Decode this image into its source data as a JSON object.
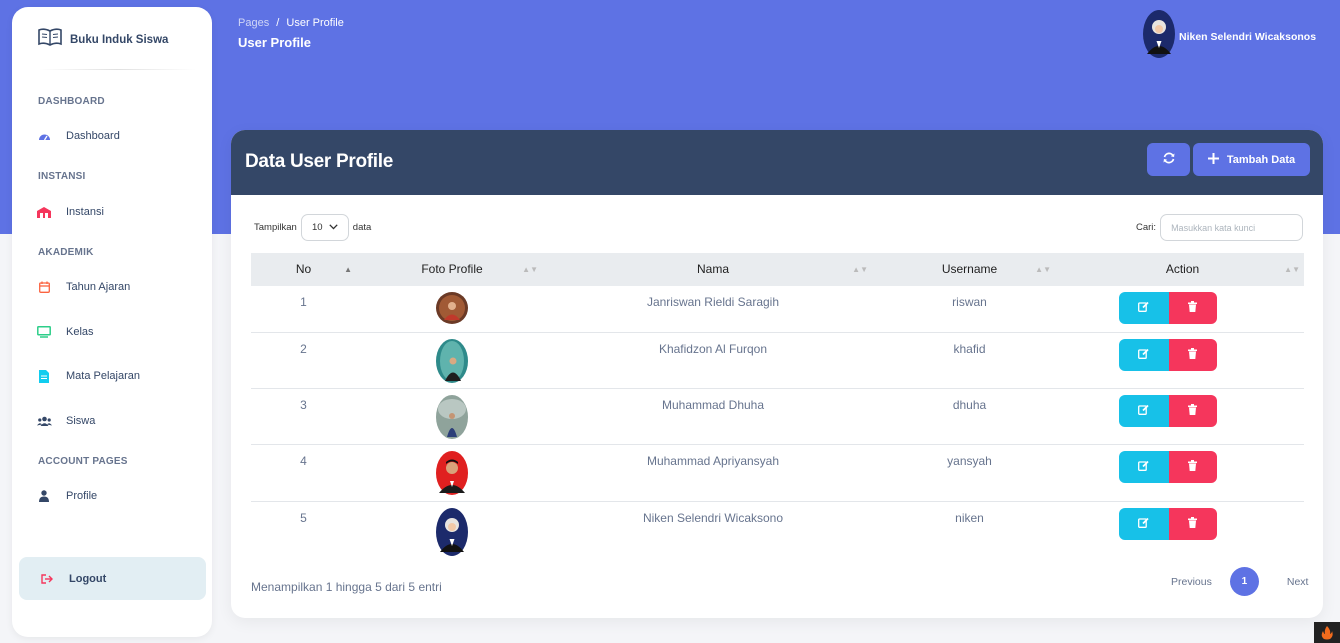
{
  "brand": {
    "name": "Buku Induk Siswa"
  },
  "sidebar": {
    "sections": {
      "dashboard": "DASHBOARD",
      "instansi": "INSTANSI",
      "akademik": "AKADEMIK",
      "account": "ACCOUNT PAGES"
    },
    "items": [
      {
        "label": "Dashboard",
        "icon": "gauge-icon",
        "color": "#5e72e4"
      },
      {
        "label": "Instansi",
        "icon": "building-icon",
        "color": "#f5365c"
      },
      {
        "label": "Tahun Ajaran",
        "icon": "calendar-icon",
        "color": "#fb6340"
      },
      {
        "label": "Kelas",
        "icon": "monitor-icon",
        "color": "#2dce89"
      },
      {
        "label": "Mata Pelajaran",
        "icon": "document-icon",
        "color": "#11cdef"
      },
      {
        "label": "Siswa",
        "icon": "users-icon",
        "color": "#344767"
      },
      {
        "label": "Profile",
        "icon": "user-icon",
        "color": "#344767"
      }
    ],
    "logout": "Logout"
  },
  "header": {
    "breadcrumb_root": "Pages",
    "breadcrumb_sep": "/",
    "breadcrumb_current": "User Profile",
    "title": "User Profile",
    "user_name": "Niken Selendri Wicaksonos"
  },
  "card": {
    "title": "Data User Profile",
    "add_label": "Tambah Data"
  },
  "table_controls": {
    "show_prefix": "Tampilkan",
    "show_value": "10",
    "show_suffix": "data",
    "search_label": "Cari:",
    "search_placeholder": "Masukkan kata kunci"
  },
  "table": {
    "columns": [
      "No",
      "Foto Profile",
      "Nama",
      "Username",
      "Action"
    ],
    "rows": [
      {
        "no": "1",
        "nama": "Janriswan Rieldi Saragih",
        "username": "riswan"
      },
      {
        "no": "2",
        "nama": "Khafidzon Al Furqon",
        "username": "khafid"
      },
      {
        "no": "3",
        "nama": "Muhammad Dhuha",
        "username": "dhuha"
      },
      {
        "no": "4",
        "nama": "Muhammad Apriyansyah",
        "username": "yansyah"
      },
      {
        "no": "5",
        "nama": "Niken Selendri Wicaksono",
        "username": "niken"
      }
    ]
  },
  "footer": {
    "info": "Menampilkan 1 hingga 5 dari 5 entri",
    "prev": "Previous",
    "page": "1",
    "next": "Next"
  },
  "colors": {
    "primary": "#5e72e4",
    "dark": "#344767",
    "info": "#17c1e8",
    "danger": "#f5365c"
  }
}
